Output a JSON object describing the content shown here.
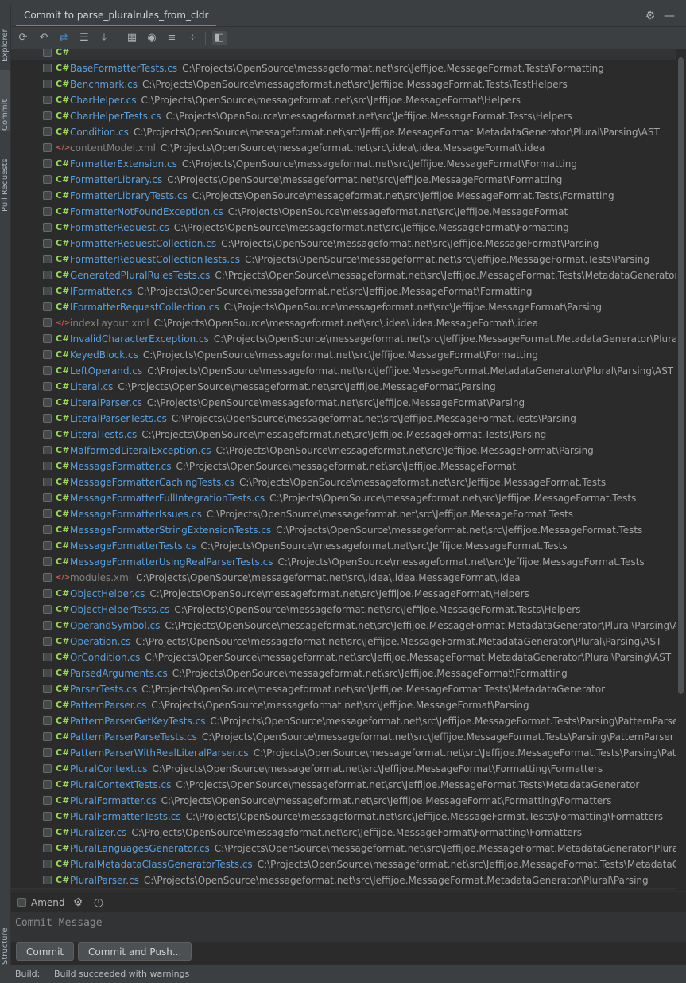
{
  "window": {
    "panel_title": "Commit to parse_pluralrules_from_cldr",
    "side_tabs": {
      "explorer": "Explorer",
      "commit": "Commit",
      "pull_requests": "Pull Requests",
      "structure": "Structure"
    }
  },
  "toolbar": {
    "icons": [
      "refresh-icon",
      "rollback-icon",
      "diff-icon",
      "changelist-icon",
      "shelve-icon",
      "group-by-icon",
      "preview-icon",
      "expand-all-icon",
      "collapse-all-icon",
      "details-panel-icon"
    ]
  },
  "files": [
    {
      "name": "BaseFormatterTests.cs",
      "type": "cs",
      "path": "C:\\Projects\\OpenSource\\messageformat.net\\src\\Jeffijoe.MessageFormat.Tests\\Formatting"
    },
    {
      "name": "Benchmark.cs",
      "type": "cs",
      "path": "C:\\Projects\\OpenSource\\messageformat.net\\src\\Jeffijoe.MessageFormat.Tests\\TestHelpers"
    },
    {
      "name": "CharHelper.cs",
      "type": "cs",
      "path": "C:\\Projects\\OpenSource\\messageformat.net\\src\\Jeffijoe.MessageFormat\\Helpers"
    },
    {
      "name": "CharHelperTests.cs",
      "type": "cs",
      "path": "C:\\Projects\\OpenSource\\messageformat.net\\src\\Jeffijoe.MessageFormat.Tests\\Helpers"
    },
    {
      "name": "Condition.cs",
      "type": "cs",
      "path": "C:\\Projects\\OpenSource\\messageformat.net\\src\\Jeffijoe.MessageFormat.MetadataGenerator\\Plural\\Parsing\\AST"
    },
    {
      "name": "contentModel.xml",
      "type": "xml",
      "path": "C:\\Projects\\OpenSource\\messageformat.net\\src\\.idea\\.idea.MessageFormat\\.idea"
    },
    {
      "name": "FormatterExtension.cs",
      "type": "cs",
      "path": "C:\\Projects\\OpenSource\\messageformat.net\\src\\Jeffijoe.MessageFormat\\Formatting"
    },
    {
      "name": "FormatterLibrary.cs",
      "type": "cs",
      "path": "C:\\Projects\\OpenSource\\messageformat.net\\src\\Jeffijoe.MessageFormat\\Formatting"
    },
    {
      "name": "FormatterLibraryTests.cs",
      "type": "cs",
      "path": "C:\\Projects\\OpenSource\\messageformat.net\\src\\Jeffijoe.MessageFormat.Tests\\Formatting"
    },
    {
      "name": "FormatterNotFoundException.cs",
      "type": "cs",
      "path": "C:\\Projects\\OpenSource\\messageformat.net\\src\\Jeffijoe.MessageFormat"
    },
    {
      "name": "FormatterRequest.cs",
      "type": "cs",
      "path": "C:\\Projects\\OpenSource\\messageformat.net\\src\\Jeffijoe.MessageFormat\\Formatting"
    },
    {
      "name": "FormatterRequestCollection.cs",
      "type": "cs",
      "path": "C:\\Projects\\OpenSource\\messageformat.net\\src\\Jeffijoe.MessageFormat\\Parsing"
    },
    {
      "name": "FormatterRequestCollectionTests.cs",
      "type": "cs",
      "path": "C:\\Projects\\OpenSource\\messageformat.net\\src\\Jeffijoe.MessageFormat.Tests\\Parsing"
    },
    {
      "name": "GeneratedPluralRulesTests.cs",
      "type": "cs",
      "path": "C:\\Projects\\OpenSource\\messageformat.net\\src\\Jeffijoe.MessageFormat.Tests\\MetadataGenerator"
    },
    {
      "name": "IFormatter.cs",
      "type": "cs",
      "path": "C:\\Projects\\OpenSource\\messageformat.net\\src\\Jeffijoe.MessageFormat\\Formatting"
    },
    {
      "name": "IFormatterRequestCollection.cs",
      "type": "cs",
      "path": "C:\\Projects\\OpenSource\\messageformat.net\\src\\Jeffijoe.MessageFormat\\Parsing"
    },
    {
      "name": "indexLayout.xml",
      "type": "xml",
      "path": "C:\\Projects\\OpenSource\\messageformat.net\\src\\.idea\\.idea.MessageFormat\\.idea"
    },
    {
      "name": "InvalidCharacterException.cs",
      "type": "cs",
      "path": "C:\\Projects\\OpenSource\\messageformat.net\\src\\Jeffijoe.MessageFormat.MetadataGenerator\\Plural\\Parsing"
    },
    {
      "name": "KeyedBlock.cs",
      "type": "cs",
      "path": "C:\\Projects\\OpenSource\\messageformat.net\\src\\Jeffijoe.MessageFormat\\Formatting"
    },
    {
      "name": "LeftOperand.cs",
      "type": "cs",
      "path": "C:\\Projects\\OpenSource\\messageformat.net\\src\\Jeffijoe.MessageFormat.MetadataGenerator\\Plural\\Parsing\\AST"
    },
    {
      "name": "Literal.cs",
      "type": "cs",
      "path": "C:\\Projects\\OpenSource\\messageformat.net\\src\\Jeffijoe.MessageFormat\\Parsing"
    },
    {
      "name": "LiteralParser.cs",
      "type": "cs",
      "path": "C:\\Projects\\OpenSource\\messageformat.net\\src\\Jeffijoe.MessageFormat\\Parsing"
    },
    {
      "name": "LiteralParserTests.cs",
      "type": "cs",
      "path": "C:\\Projects\\OpenSource\\messageformat.net\\src\\Jeffijoe.MessageFormat.Tests\\Parsing"
    },
    {
      "name": "LiteralTests.cs",
      "type": "cs",
      "path": "C:\\Projects\\OpenSource\\messageformat.net\\src\\Jeffijoe.MessageFormat.Tests\\Parsing"
    },
    {
      "name": "MalformedLiteralException.cs",
      "type": "cs",
      "path": "C:\\Projects\\OpenSource\\messageformat.net\\src\\Jeffijoe.MessageFormat\\Parsing"
    },
    {
      "name": "MessageFormatter.cs",
      "type": "cs",
      "path": "C:\\Projects\\OpenSource\\messageformat.net\\src\\Jeffijoe.MessageFormat"
    },
    {
      "name": "MessageFormatterCachingTests.cs",
      "type": "cs",
      "path": "C:\\Projects\\OpenSource\\messageformat.net\\src\\Jeffijoe.MessageFormat.Tests"
    },
    {
      "name": "MessageFormatterFullIntegrationTests.cs",
      "type": "cs",
      "path": "C:\\Projects\\OpenSource\\messageformat.net\\src\\Jeffijoe.MessageFormat.Tests"
    },
    {
      "name": "MessageFormatterIssues.cs",
      "type": "cs",
      "path": "C:\\Projects\\OpenSource\\messageformat.net\\src\\Jeffijoe.MessageFormat.Tests"
    },
    {
      "name": "MessageFormatterStringExtensionTests.cs",
      "type": "cs",
      "path": "C:\\Projects\\OpenSource\\messageformat.net\\src\\Jeffijoe.MessageFormat.Tests"
    },
    {
      "name": "MessageFormatterTests.cs",
      "type": "cs",
      "path": "C:\\Projects\\OpenSource\\messageformat.net\\src\\Jeffijoe.MessageFormat.Tests"
    },
    {
      "name": "MessageFormatterUsingRealParserTests.cs",
      "type": "cs",
      "path": "C:\\Projects\\OpenSource\\messageformat.net\\src\\Jeffijoe.MessageFormat.Tests"
    },
    {
      "name": "modules.xml",
      "type": "xml",
      "path": "C:\\Projects\\OpenSource\\messageformat.net\\src\\.idea\\.idea.MessageFormat\\.idea"
    },
    {
      "name": "ObjectHelper.cs",
      "type": "cs",
      "path": "C:\\Projects\\OpenSource\\messageformat.net\\src\\Jeffijoe.MessageFormat\\Helpers"
    },
    {
      "name": "ObjectHelperTests.cs",
      "type": "cs",
      "path": "C:\\Projects\\OpenSource\\messageformat.net\\src\\Jeffijoe.MessageFormat.Tests\\Helpers"
    },
    {
      "name": "OperandSymbol.cs",
      "type": "cs",
      "path": "C:\\Projects\\OpenSource\\messageformat.net\\src\\Jeffijoe.MessageFormat.MetadataGenerator\\Plural\\Parsing\\AST"
    },
    {
      "name": "Operation.cs",
      "type": "cs",
      "path": "C:\\Projects\\OpenSource\\messageformat.net\\src\\Jeffijoe.MessageFormat.MetadataGenerator\\Plural\\Parsing\\AST"
    },
    {
      "name": "OrCondition.cs",
      "type": "cs",
      "path": "C:\\Projects\\OpenSource\\messageformat.net\\src\\Jeffijoe.MessageFormat.MetadataGenerator\\Plural\\Parsing\\AST"
    },
    {
      "name": "ParsedArguments.cs",
      "type": "cs",
      "path": "C:\\Projects\\OpenSource\\messageformat.net\\src\\Jeffijoe.MessageFormat\\Formatting"
    },
    {
      "name": "ParserTests.cs",
      "type": "cs",
      "path": "C:\\Projects\\OpenSource\\messageformat.net\\src\\Jeffijoe.MessageFormat.Tests\\MetadataGenerator"
    },
    {
      "name": "PatternParser.cs",
      "type": "cs",
      "path": "C:\\Projects\\OpenSource\\messageformat.net\\src\\Jeffijoe.MessageFormat\\Parsing"
    },
    {
      "name": "PatternParserGetKeyTests.cs",
      "type": "cs",
      "path": "C:\\Projects\\OpenSource\\messageformat.net\\src\\Jeffijoe.MessageFormat.Tests\\Parsing\\PatternParser"
    },
    {
      "name": "PatternParserParseTests.cs",
      "type": "cs",
      "path": "C:\\Projects\\OpenSource\\messageformat.net\\src\\Jeffijoe.MessageFormat.Tests\\Parsing\\PatternParser"
    },
    {
      "name": "PatternParserWithRealLiteralParser.cs",
      "type": "cs",
      "path": "C:\\Projects\\OpenSource\\messageformat.net\\src\\Jeffijoe.MessageFormat.Tests\\Parsing\\PatternParser"
    },
    {
      "name": "PluralContext.cs",
      "type": "cs",
      "path": "C:\\Projects\\OpenSource\\messageformat.net\\src\\Jeffijoe.MessageFormat\\Formatting\\Formatters"
    },
    {
      "name": "PluralContextTests.cs",
      "type": "cs",
      "path": "C:\\Projects\\OpenSource\\messageformat.net\\src\\Jeffijoe.MessageFormat.Tests\\MetadataGenerator"
    },
    {
      "name": "PluralFormatter.cs",
      "type": "cs",
      "path": "C:\\Projects\\OpenSource\\messageformat.net\\src\\Jeffijoe.MessageFormat\\Formatting\\Formatters"
    },
    {
      "name": "PluralFormatterTests.cs",
      "type": "cs",
      "path": "C:\\Projects\\OpenSource\\messageformat.net\\src\\Jeffijoe.MessageFormat.Tests\\Formatting\\Formatters"
    },
    {
      "name": "Pluralizer.cs",
      "type": "cs",
      "path": "C:\\Projects\\OpenSource\\messageformat.net\\src\\Jeffijoe.MessageFormat\\Formatting\\Formatters"
    },
    {
      "name": "PluralLanguagesGenerator.cs",
      "type": "cs",
      "path": "C:\\Projects\\OpenSource\\messageformat.net\\src\\Jeffijoe.MessageFormat.MetadataGenerator\\Plural"
    },
    {
      "name": "PluralMetadataClassGeneratorTests.cs",
      "type": "cs",
      "path": "C:\\Projects\\OpenSource\\messageformat.net\\src\\Jeffijoe.MessageFormat.Tests\\MetadataGenerator"
    },
    {
      "name": "PluralParser.cs",
      "type": "cs",
      "path": "C:\\Projects\\OpenSource\\messageformat.net\\src\\Jeffijoe.MessageFormat.MetadataGenerator\\Plural\\Parsing"
    }
  ],
  "file_icon_labels": {
    "cs": "C#",
    "xml": "</>"
  },
  "amend": {
    "label": "Amend"
  },
  "commit": {
    "message_placeholder": "Commit Message",
    "commit_button": "Commit",
    "commit_push_button": "Commit and Push..."
  },
  "status": {
    "label": "Build:",
    "message": "Build succeeded with warnings"
  }
}
